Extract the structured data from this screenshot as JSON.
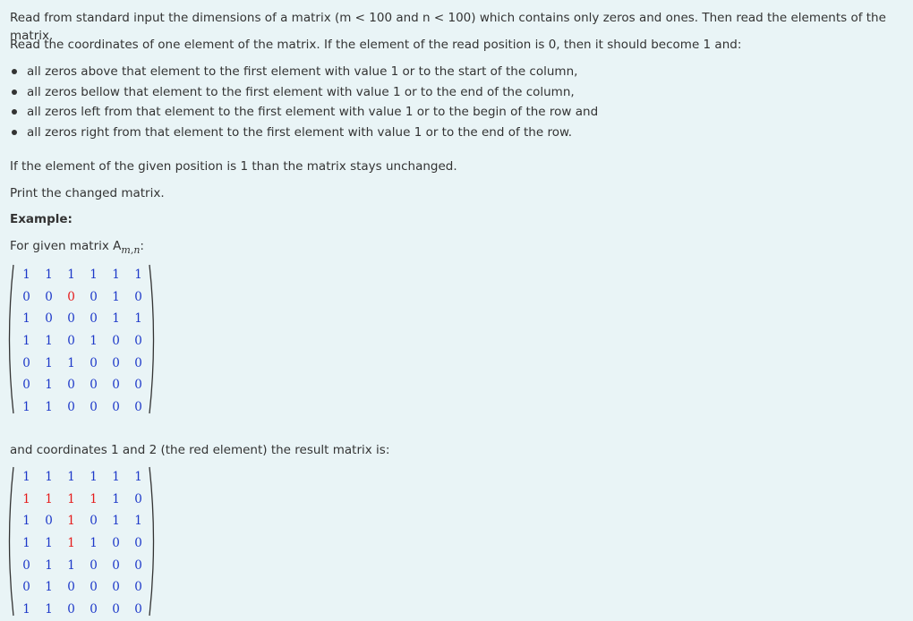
{
  "paragraphs": {
    "intro": "Read from standard input the dimensions of a matrix (m < 100 and n < 100) which contains only zeros and ones. Then read the elements of the matrix.",
    "coords": "Read the coordinates of one element of the matrix. If the element of the read position is 0, then it should become 1 and:",
    "unchanged": "If the element of the given position is 1 than the matrix stays unchanged.",
    "print": "Print the changed matrix.",
    "example_heading": "Example:",
    "given_prefix": "For given matrix A",
    "given_subscript": "m,n",
    "given_suffix": ":",
    "result": "and coordinates 1 and 2 (the red element) the result matrix is:"
  },
  "bullets": [
    "all zeros above that element to the first element with value 1 or to the start of the column,",
    "all zeros bellow that element to the first element with value 1 or to the end of the column,",
    "all zeros left from that element to the first element with value 1 or to the begin of the row and",
    "all zeros right from that element to the first element with value 1 or to the end of the row."
  ],
  "colors": {
    "normal_value": "#1d38c9",
    "highlight_value": "#e51a1a",
    "background": "#e9f4f6",
    "text": "#333333"
  },
  "matrix_before": {
    "rows": [
      [
        1,
        1,
        1,
        1,
        1,
        1
      ],
      [
        0,
        0,
        0,
        0,
        1,
        0
      ],
      [
        1,
        0,
        0,
        0,
        1,
        1
      ],
      [
        1,
        1,
        0,
        1,
        0,
        0
      ],
      [
        0,
        1,
        1,
        0,
        0,
        0
      ],
      [
        0,
        1,
        0,
        0,
        0,
        0
      ],
      [
        1,
        1,
        0,
        0,
        0,
        0
      ]
    ],
    "highlight": [
      [
        1,
        2
      ]
    ]
  },
  "matrix_after": {
    "rows": [
      [
        1,
        1,
        1,
        1,
        1,
        1
      ],
      [
        1,
        1,
        1,
        1,
        1,
        0
      ],
      [
        1,
        0,
        1,
        0,
        1,
        1
      ],
      [
        1,
        1,
        1,
        1,
        0,
        0
      ],
      [
        0,
        1,
        1,
        0,
        0,
        0
      ],
      [
        0,
        1,
        0,
        0,
        0,
        0
      ],
      [
        1,
        1,
        0,
        0,
        0,
        0
      ]
    ],
    "highlight": [
      [
        1,
        0
      ],
      [
        1,
        1
      ],
      [
        1,
        2
      ],
      [
        1,
        3
      ],
      [
        2,
        2
      ],
      [
        3,
        2
      ]
    ]
  }
}
